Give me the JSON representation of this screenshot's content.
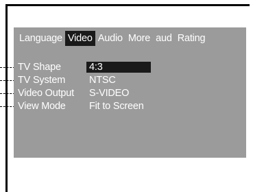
{
  "menu": {
    "tabs": [
      {
        "label": "Language"
      },
      {
        "label": "Video"
      },
      {
        "label": "Audio"
      },
      {
        "label": "More"
      },
      {
        "label": "aud"
      },
      {
        "label": "Rating"
      }
    ],
    "active_tab": "Video"
  },
  "settings": [
    {
      "label": "TV Shape",
      "value": "4:3",
      "selected": true
    },
    {
      "label": "TV System",
      "value": "NTSC",
      "selected": false
    },
    {
      "label": "Video Output",
      "value": "S-VIDEO",
      "selected": false
    },
    {
      "label": "View Mode",
      "value": "Fit to Screen",
      "selected": false
    }
  ],
  "colors": {
    "screen_bg": "#9b9b9b",
    "highlight": "#1a1a1a",
    "text": "#ffffff"
  }
}
